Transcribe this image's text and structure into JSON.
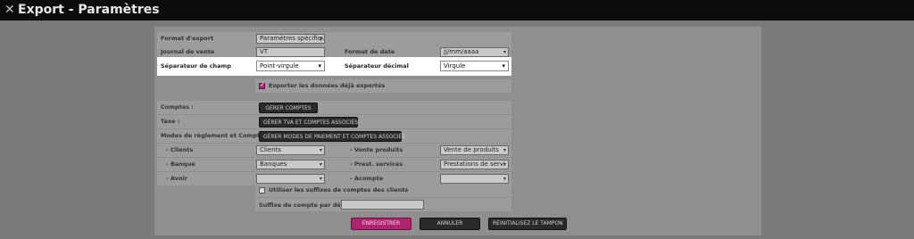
{
  "window": {
    "title": "Export - Paramètres",
    "close_icon": "close-icon"
  },
  "form": {
    "format_export": {
      "label": "Format d'export",
      "value": "Paramètres spécifiqu"
    },
    "journal_vente": {
      "label": "Journal de vente",
      "value": "VT"
    },
    "format_date": {
      "label": "Format de date",
      "value": "jj/mm/aaaa"
    },
    "separateur_champ": {
      "label": "Séparateur de champ",
      "value": "Point-virgule"
    },
    "separateur_decimal": {
      "label": "Séparateur décimal",
      "value": "Virgule"
    },
    "exporter_deja": {
      "label": "Exporter les données déjà exportés",
      "checked": true
    },
    "comptes": {
      "label": "Comptes :",
      "button": "GÉRER COMPTES"
    },
    "taxe": {
      "label": "Taxe :",
      "button": "GÉRER TVA ET COMPTES ASSOCIÉS"
    },
    "modes": {
      "label": "Modes de règlement et Comptes :",
      "button": "GÉRER MODES DE PAIEMENT ET COMPTES ASSOCIÉS"
    },
    "clients": {
      "label": "- Clients",
      "value": "Clients"
    },
    "vente_produits": {
      "label": "- Vente produits",
      "value": "Vente de produits"
    },
    "banque": {
      "label": "- Banque",
      "value": "Banques"
    },
    "prest_services": {
      "label": "- Prest. services",
      "value": "Prestations de servi"
    },
    "avoir": {
      "label": "- Avoir",
      "value": ""
    },
    "acompte": {
      "label": "- Acompte",
      "value": ""
    },
    "suffixes": {
      "label": "Utiliser les suffixes de comptes des clients",
      "checked": false
    },
    "suffixe_defaut": {
      "label": "Suffixe de compte par défaut",
      "value": ""
    }
  },
  "actions": {
    "save": "ENREGISTRER",
    "cancel": "ANNULER",
    "reset": "RÉINITIALISEZ LE TAMPON"
  },
  "colors": {
    "title_bar": "#0d0d0d",
    "accent": "#b0246f",
    "highlight": "#ffffff"
  }
}
